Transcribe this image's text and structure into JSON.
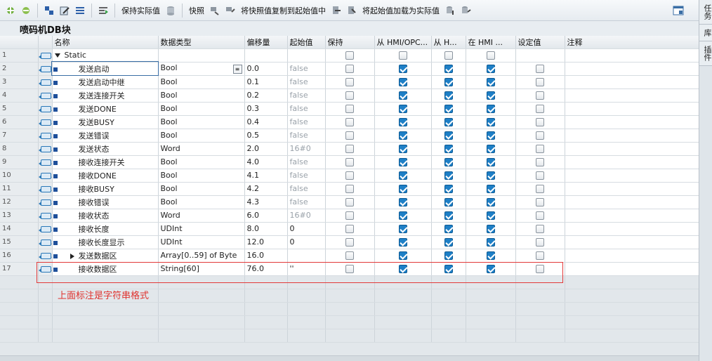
{
  "toolbar": {
    "keep_actual": "保持实际值",
    "snapshot": "快照",
    "copy_snapshot_to_start": "将快照值复制到起始值中",
    "load_start_as_actual": "将起始值加载为实际值"
  },
  "block_title": "喷码机DB块",
  "columns": {
    "name": "名称",
    "datatype": "数据类型",
    "offset": "偏移量",
    "start": "起始值",
    "retain": "保持",
    "hmi_opc": "从 HMI/OPC...",
    "hmi_h": "从 H...",
    "in_hmi": "在 HMI ...",
    "setpoint": "设定值",
    "comment": "注释"
  },
  "static_row": {
    "num": "1",
    "name": "Static"
  },
  "rows": [
    {
      "num": "2",
      "name": "发送启动",
      "type": "Bool",
      "offset": "0.0",
      "start": "false"
    },
    {
      "num": "3",
      "name": "发送启动中继",
      "type": "Bool",
      "offset": "0.1",
      "start": "false"
    },
    {
      "num": "4",
      "name": "发送连接开关",
      "type": "Bool",
      "offset": "0.2",
      "start": "false"
    },
    {
      "num": "5",
      "name": "发送DONE",
      "type": "Bool",
      "offset": "0.3",
      "start": "false"
    },
    {
      "num": "6",
      "name": "发送BUSY",
      "type": "Bool",
      "offset": "0.4",
      "start": "false"
    },
    {
      "num": "7",
      "name": "发送错误",
      "type": "Bool",
      "offset": "0.5",
      "start": "false"
    },
    {
      "num": "8",
      "name": "发送状态",
      "type": "Word",
      "offset": "2.0",
      "start": "16#0"
    },
    {
      "num": "9",
      "name": "接收连接开关",
      "type": "Bool",
      "offset": "4.0",
      "start": "false"
    },
    {
      "num": "10",
      "name": "接收DONE",
      "type": "Bool",
      "offset": "4.1",
      "start": "false"
    },
    {
      "num": "11",
      "name": "接收BUSY",
      "type": "Bool",
      "offset": "4.2",
      "start": "false"
    },
    {
      "num": "12",
      "name": "接收错误",
      "type": "Bool",
      "offset": "4.3",
      "start": "false"
    },
    {
      "num": "13",
      "name": "接收状态",
      "type": "Word",
      "offset": "6.0",
      "start": "16#0"
    },
    {
      "num": "14",
      "name": "接收长度",
      "type": "UDInt",
      "offset": "8.0",
      "start": "0"
    },
    {
      "num": "15",
      "name": "接收长度显示",
      "type": "UDInt",
      "offset": "12.0",
      "start": "0"
    },
    {
      "num": "16",
      "name": "发送数据区",
      "type": "Array[0..59] of Byte",
      "offset": "16.0",
      "start": ""
    },
    {
      "num": "17",
      "name": "接收数据区",
      "type": "String[60]",
      "offset": "76.0",
      "start": "''"
    }
  ],
  "annotation": "上面标注是字符串格式",
  "side_tabs": [
    "任务",
    "库",
    "插件"
  ]
}
